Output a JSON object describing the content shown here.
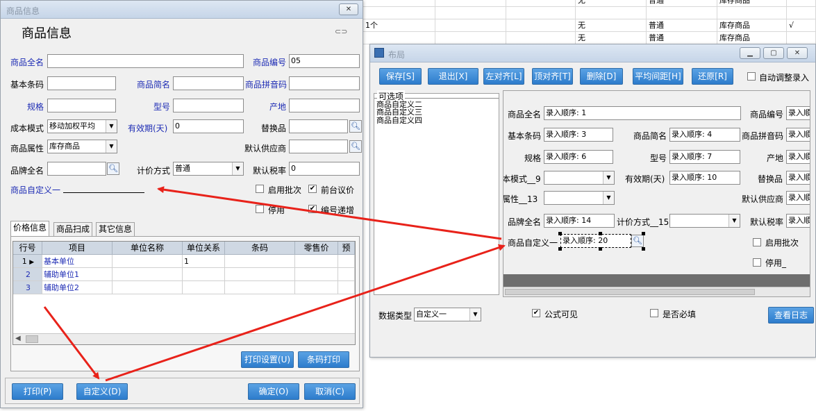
{
  "background_table": {
    "rows": [
      {
        "c1": "",
        "c2": "无",
        "c3": "普通",
        "c4": "库存商品",
        "c5": ""
      },
      {
        "c1": "1个",
        "c2": "无",
        "c3": "普通",
        "c4": "库存商品",
        "c5": "√"
      },
      {
        "c1": "",
        "c2": "无",
        "c3": "普通",
        "c4": "库存商品",
        "c5": ""
      }
    ]
  },
  "product_window": {
    "title": "商品信息",
    "heading": "商品信息",
    "close_label": "✕",
    "fields": {
      "full_name_label": "商品全名",
      "full_name_value": "",
      "code_label": "商品编号",
      "code_value": "05",
      "barcode_label": "基本条码",
      "short_name_label": "商品简名",
      "pinyin_label": "商品拼音码",
      "spec_label": "规格",
      "model_label": "型号",
      "origin_label": "产地",
      "cost_mode_label": "成本模式",
      "cost_mode_value": "移动加权平均",
      "validity_label": "有效期(天)",
      "validity_value": "0",
      "substitute_label": "替换品",
      "attr_label": "商品属性",
      "attr_value": "库存商品",
      "supplier_label": "默认供应商",
      "brand_label": "品牌全名",
      "pricing_label": "计价方式",
      "pricing_value": "普通",
      "tax_label": "默认税率",
      "tax_value": "0",
      "custom1_label": "商品自定义一"
    },
    "checks": {
      "batch": "启用批次",
      "batch_checked": "",
      "front_price": "前台议价",
      "front_price_checked": "✔",
      "disable": "停用",
      "disable_checked": "",
      "auto_code": "编号递增",
      "auto_code_checked": "✔"
    },
    "tabs": [
      "价格信息",
      "商品扫成",
      "其它信息"
    ],
    "grid": {
      "headers": [
        "行号",
        "项目",
        "单位名称",
        "单位关系",
        "条码",
        "零售价",
        "预设"
      ],
      "rows": [
        {
          "no": "1",
          "item": "基本单位",
          "unit": "",
          "rel": "1"
        },
        {
          "no": "2",
          "item": "辅助单位1",
          "unit": "",
          "rel": ""
        },
        {
          "no": "3",
          "item": "辅助单位2",
          "unit": "",
          "rel": ""
        }
      ]
    },
    "buttons": {
      "print_setup": "打印设置(U)",
      "barcode_print": "条码打印",
      "print": "打印(P)",
      "customize": "自定义(D)",
      "ok": "确定(O)",
      "cancel": "取消(C)"
    }
  },
  "layout_window": {
    "title": "布局",
    "toolbar": [
      "保存[S]",
      "退出[X]",
      "左对齐[L]",
      "顶对齐[T]",
      "删除[D]",
      "平均间距[H]",
      "还原[R]"
    ],
    "auto_adjust": "自动调整录入",
    "options_title": "可选项",
    "options": [
      "商品自定义二",
      "商品自定义三",
      "商品自定义四"
    ],
    "design": {
      "full_name_label": "商品全名",
      "full_name_value": "录入顺序: 1",
      "code_label": "商品编号",
      "code_value": "录入顺",
      "barcode_label": "基本条码",
      "barcode_value": "录入顺序: 3",
      "short_name_label": "商品简名",
      "short_name_value": "录入顺序: 4",
      "pinyin_label": "商品拼音码",
      "pinyin_value": "录入顺",
      "spec_label": "规格",
      "spec_value": "录入顺序: 6",
      "model_label": "型号",
      "model_value": "录入顺序: 7",
      "origin_label": "产地",
      "origin_value": "录入顺",
      "cost_mode_label": "本模式__9",
      "validity_label": "有效期(天)",
      "validity_value": "录入顺序: 10",
      "substitute_label": "替换品",
      "substitute_value": "录入顺",
      "attr_label": "属性__13",
      "supplier_label": "默认供应商",
      "supplier_value": "录入顺",
      "brand_label": "品牌全名",
      "brand_value": "录入顺序: 14",
      "pricing_label": "计价方式__15",
      "tax_label": "默认税率",
      "tax_value": "录入顺",
      "custom1_label": "商品自定义一",
      "custom1_value": "录入顺序: 20",
      "batch": "启用批次",
      "disable": "停用_"
    },
    "bottom": {
      "data_type_label": "数据类型",
      "data_type_value": "自定义一",
      "formula_visible": "公式可见",
      "formula_checked": "✔",
      "required": "是否必填",
      "view_log": "查看日志"
    }
  }
}
